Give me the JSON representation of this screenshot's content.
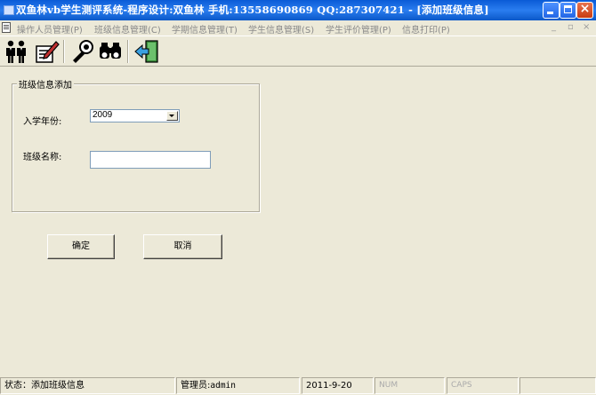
{
  "window": {
    "title": "双鱼林vb学生测评系统-程序设计:双鱼林 手机:13558690869 QQ:287307421 - [添加班级信息]"
  },
  "menu": {
    "items": [
      {
        "label": "操作人员管理(P)"
      },
      {
        "label": "班级信息管理(C)"
      },
      {
        "label": "学期信息管理(T)"
      },
      {
        "label": "学生信息管理(S)"
      },
      {
        "label": "学生评价管理(P)"
      },
      {
        "label": "信息打印(P)"
      }
    ],
    "mdi_minimize": "_",
    "mdi_restore": "▫",
    "mdi_close": "×"
  },
  "toolbar": {
    "icons": [
      "users-icon",
      "edit-icon",
      "settings-icon",
      "search-icon",
      "exit-icon"
    ]
  },
  "form": {
    "group_title": "班级信息添加",
    "year_label": "入学年份:",
    "year_value": "2009",
    "class_name_label": "班级名称:",
    "class_name_value": "",
    "confirm_label": "确定",
    "cancel_label": "取消"
  },
  "status": {
    "state": "状态：添加班级信息",
    "admin_label": "管理员:",
    "admin_user": "admin",
    "date": "2011-9-20",
    "num": "NUM",
    "caps": "CAPS"
  },
  "colors": {
    "titlebar": "#0a5bd6",
    "window_bg": "#ece9d8",
    "close_button": "#c83c12"
  }
}
